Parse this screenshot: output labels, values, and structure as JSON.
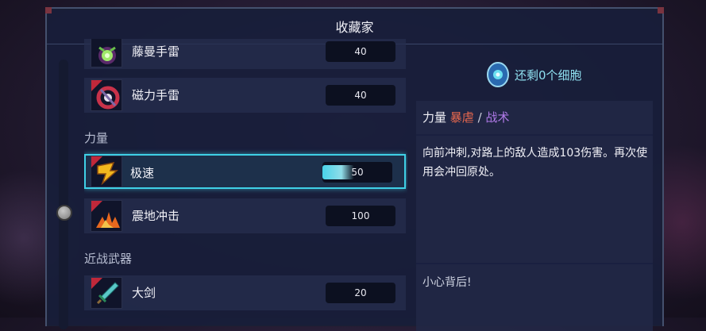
{
  "window": {
    "title": "收藏家"
  },
  "items": [
    {
      "name": "藤曼手雷",
      "cost": "40",
      "icon": "vine-grenade-icon"
    },
    {
      "name": "磁力手雷",
      "cost": "40",
      "icon": "magnet-grenade-icon"
    },
    {
      "name": "极速",
      "cost": "50",
      "icon": "speed-icon"
    },
    {
      "name": "震地冲击",
      "cost": "100",
      "icon": "ground-smash-icon"
    },
    {
      "name": "大剑",
      "cost": "20",
      "icon": "broadsword-icon"
    }
  ],
  "sections": {
    "power": "力量",
    "melee": "近战武器"
  },
  "cells": {
    "text": "还剩0个细胞"
  },
  "detail": {
    "tag_power": "力量",
    "tag_brutal": "暴虐",
    "tag_sep": "/",
    "tag_tactic": "战术",
    "description": "向前冲刺,对路上的敌人造成103伤害。再次使用会冲回原处。",
    "hint": "小心背后!"
  },
  "colors": {
    "selection": "#3fd0e6",
    "brutal": "#e8684e",
    "tactic": "#b07ae8",
    "cells": "#8fe0f0"
  }
}
